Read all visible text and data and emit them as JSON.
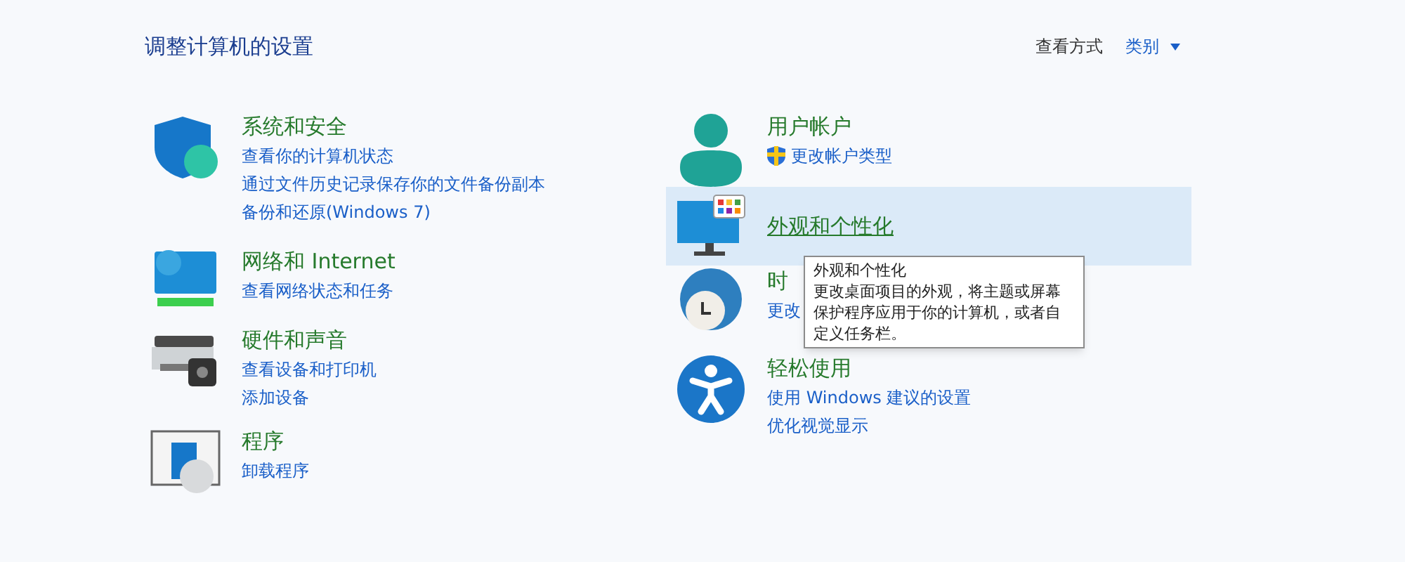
{
  "heading": "调整计算机的设置",
  "view": {
    "label": "查看方式",
    "value": "类别"
  },
  "left_column": [
    {
      "title": "系统和安全",
      "highlighted": false,
      "links": [
        {
          "text": "查看你的计算机状态",
          "shield": false
        },
        {
          "text": "通过文件历史记录保存你的文件备份副本",
          "shield": false
        },
        {
          "text": "备份和还原(Windows 7)",
          "shield": false
        }
      ]
    },
    {
      "title": "网络和 Internet",
      "highlighted": false,
      "links": [
        {
          "text": "查看网络状态和任务",
          "shield": false
        }
      ]
    },
    {
      "title": "硬件和声音",
      "highlighted": false,
      "links": [
        {
          "text": "查看设备和打印机",
          "shield": false
        },
        {
          "text": "添加设备",
          "shield": false
        }
      ]
    },
    {
      "title": "程序",
      "highlighted": false,
      "links": [
        {
          "text": "卸载程序",
          "shield": false
        }
      ]
    }
  ],
  "right_column": [
    {
      "title": "用户帐户",
      "highlighted": false,
      "links": [
        {
          "text": "更改帐户类型",
          "shield": true
        }
      ]
    },
    {
      "title": "外观和个性化",
      "highlighted": true
    },
    {
      "title": "时",
      "highlighted": false,
      "links": [
        {
          "text": "更改",
          "shield": false
        }
      ]
    },
    {
      "title": "轻松使用",
      "highlighted": false,
      "links": [
        {
          "text": "使用 Windows 建议的设置",
          "shield": false
        },
        {
          "text": "优化视觉显示",
          "shield": false
        }
      ]
    }
  ],
  "tooltip": {
    "title": "外观和个性化",
    "text": "更改桌面项目的外观，将主题或屏幕保护程序应用于你的计算机，或者自定义任务栏。"
  }
}
